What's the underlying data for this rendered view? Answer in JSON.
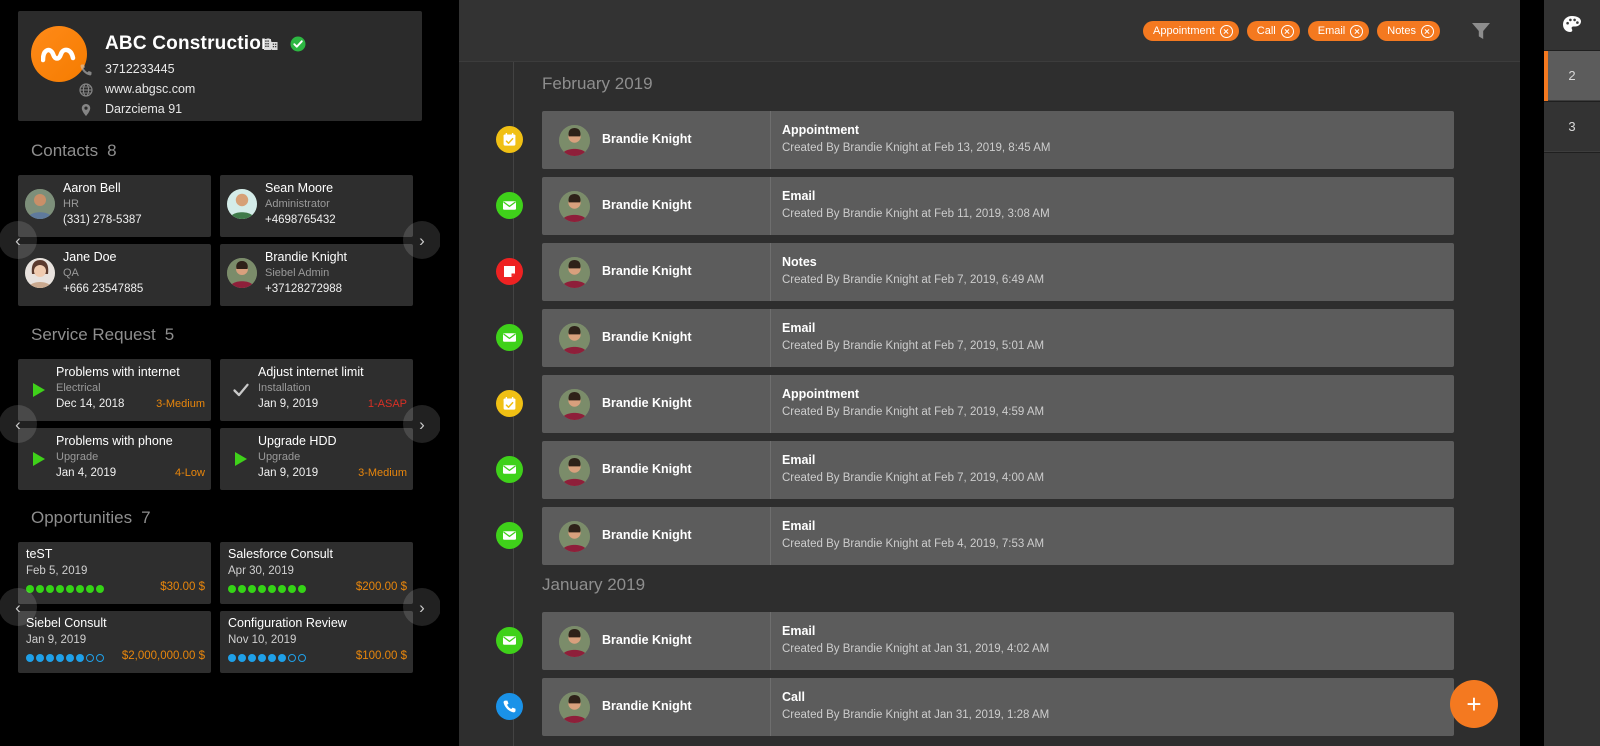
{
  "company": {
    "name": "ABC Construction",
    "phone": "3712233445",
    "website": "www.abgsc.com",
    "address": "Darzciema 91",
    "logo_color": "#f57c00",
    "verified_color": "#2db742",
    "building_icon": "building-icon",
    "verified_icon": "verified-check-icon",
    "phone_icon": "phone-icon",
    "globe_icon": "globe-icon",
    "pin_icon": "location-pin-icon"
  },
  "sections": {
    "contacts": {
      "title": "Contacts",
      "count": "8",
      "items": [
        {
          "name": "Aaron Bell",
          "role": "HR",
          "phone": "(331) 278-5387"
        },
        {
          "name": "Sean Moore",
          "role": "Administrator",
          "phone": "+4698765432"
        },
        {
          "name": "Jane Doe",
          "role": "QA",
          "phone": "+666 23547885"
        },
        {
          "name": "Brandie Knight",
          "role": "Siebel Admin",
          "phone": "+37128272988"
        }
      ]
    },
    "service_request": {
      "title": "Service Request",
      "count": "5",
      "items": [
        {
          "title": "Problems with internet",
          "type": "Electrical",
          "date": "Dec 14, 2018",
          "priority": "3-Medium",
          "priority_class": "pri-med",
          "status_icon": "play-triangle-icon"
        },
        {
          "title": "Adjust internet limit",
          "type": "Installation",
          "date": "Jan 9, 2019",
          "priority": "1-ASAP",
          "priority_class": "pri-asap",
          "status_icon": "check-icon"
        },
        {
          "title": "Problems with phone",
          "type": "Upgrade",
          "date": "Jan 4, 2019",
          "priority": "4-Low",
          "priority_class": "pri-low",
          "status_icon": "play-triangle-icon"
        },
        {
          "title": "Upgrade HDD",
          "type": "Upgrade",
          "date": "Jan 9, 2019",
          "priority": "3-Medium",
          "priority_class": "pri-med",
          "status_icon": "play-triangle-icon"
        }
      ]
    },
    "opportunities": {
      "title": "Opportunities",
      "count": "7",
      "items": [
        {
          "title": "teST",
          "date": "Feb 5, 2019",
          "amount": "$30.00 $",
          "dots_filled": 8,
          "dots_total": 8,
          "dot_color": "green"
        },
        {
          "title": "Salesforce Consult",
          "date": "Apr 30, 2019",
          "amount": "$200.00 $",
          "dots_filled": 8,
          "dots_total": 8,
          "dot_color": "green"
        },
        {
          "title": "Siebel Consult",
          "date": "Jan 9, 2019",
          "amount": "$2,000,000.00 $",
          "dots_filled": 6,
          "dots_total": 8,
          "dot_color": "blue"
        },
        {
          "title": "Configuration Review",
          "date": "Nov 10, 2019",
          "amount": "$100.00 $",
          "dots_filled": 6,
          "dots_total": 8,
          "dot_color": "blue"
        }
      ]
    }
  },
  "carousel": {
    "prev_label": "‹",
    "next_label": "›"
  },
  "topbar": {
    "chips": [
      {
        "label": "Appointment",
        "close_icon": "close-circle-icon"
      },
      {
        "label": "Call",
        "close_icon": "close-circle-icon"
      },
      {
        "label": "Email",
        "close_icon": "close-circle-icon"
      },
      {
        "label": "Notes",
        "close_icon": "close-circle-icon"
      }
    ],
    "filter_icon": "filter-funnel-icon",
    "chip_color": "#f47920"
  },
  "timeline": {
    "groups": [
      {
        "month": "February 2019",
        "entries": [
          {
            "person": "Brandie Knight",
            "type": "Appointment",
            "meta": "Created By Brandie Knight at Feb 13, 2019, 8:45 AM",
            "kind": "appointment",
            "icon": "calendar-icon"
          },
          {
            "person": "Brandie Knight",
            "type": "Email",
            "meta": "Created By Brandie Knight at Feb 11, 2019, 3:08 AM",
            "kind": "email",
            "icon": "envelope-icon"
          },
          {
            "person": "Brandie Knight",
            "type": "Notes",
            "meta": "Created By Brandie Knight at Feb 7, 2019, 6:49 AM",
            "kind": "notes",
            "icon": "note-icon"
          },
          {
            "person": "Brandie Knight",
            "type": "Email",
            "meta": "Created By Brandie Knight at Feb 7, 2019, 5:01 AM",
            "kind": "email",
            "icon": "envelope-icon"
          },
          {
            "person": "Brandie Knight",
            "type": "Appointment",
            "meta": "Created By Brandie Knight at Feb 7, 2019, 4:59 AM",
            "kind": "appointment",
            "icon": "calendar-icon"
          },
          {
            "person": "Brandie Knight",
            "type": "Email",
            "meta": "Created By Brandie Knight at Feb 7, 2019, 4:00 AM",
            "kind": "email",
            "icon": "envelope-icon"
          },
          {
            "person": "Brandie Knight",
            "type": "Email",
            "meta": "Created By Brandie Knight at Feb 4, 2019, 7:53 AM",
            "kind": "email",
            "icon": "envelope-icon"
          }
        ]
      },
      {
        "month": "January 2019",
        "entries": [
          {
            "person": "Brandie Knight",
            "type": "Email",
            "meta": "Created By Brandie Knight at Jan 31, 2019, 4:02 AM",
            "kind": "email",
            "icon": "envelope-icon"
          },
          {
            "person": "Brandie Knight",
            "type": "Call",
            "meta": "Created By Brandie Knight at Jan 31, 2019, 1:28 AM",
            "kind": "call",
            "icon": "phone-icon"
          }
        ]
      }
    ],
    "fab_label": "+",
    "fab_color": "#f47920"
  },
  "right_rail": {
    "palette_icon": "palette-icon",
    "items": [
      {
        "label": "2",
        "active": true
      },
      {
        "label": "3",
        "active": false
      }
    ],
    "active_indicator_color": "#f47920"
  }
}
